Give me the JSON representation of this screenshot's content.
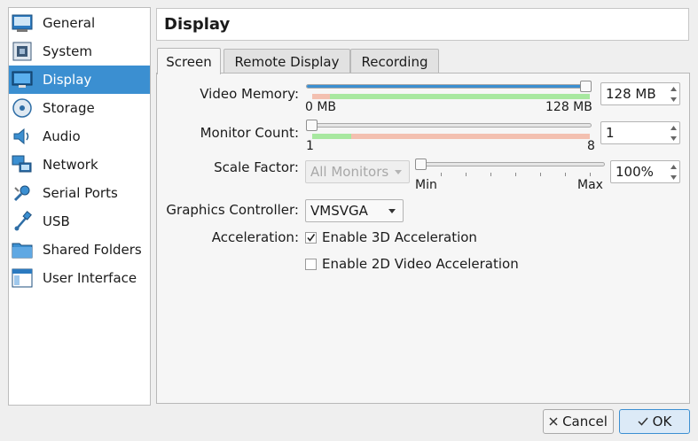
{
  "sidebar": {
    "items": [
      {
        "label": "General",
        "icon": "general-icon"
      },
      {
        "label": "System",
        "icon": "system-icon"
      },
      {
        "label": "Display",
        "icon": "display-icon",
        "selected": true
      },
      {
        "label": "Storage",
        "icon": "storage-icon"
      },
      {
        "label": "Audio",
        "icon": "audio-icon"
      },
      {
        "label": "Network",
        "icon": "network-icon"
      },
      {
        "label": "Serial Ports",
        "icon": "serial-ports-icon"
      },
      {
        "label": "USB",
        "icon": "usb-icon"
      },
      {
        "label": "Shared Folders",
        "icon": "shared-folders-icon"
      },
      {
        "label": "User Interface",
        "icon": "user-interface-icon"
      }
    ]
  },
  "header": {
    "title": "Display"
  },
  "tabs": [
    {
      "label": "Screen",
      "active": true
    },
    {
      "label": "Remote Display"
    },
    {
      "label": "Recording"
    }
  ],
  "screen": {
    "video_memory": {
      "label": "Video Memory:",
      "min_label": "0 MB",
      "max_label": "128 MB",
      "value": "128 MB",
      "fraction": 1.0
    },
    "monitor_count": {
      "label": "Monitor Count:",
      "min_label": "1",
      "max_label": "8",
      "value": "1",
      "fraction": 0.0
    },
    "scale_factor": {
      "label": "Scale Factor:",
      "combo_value": "All Monitors",
      "min_label": "Min",
      "max_label": "Max",
      "value": "100%",
      "fraction": 0.0
    },
    "graphics_controller": {
      "label": "Graphics Controller:",
      "value": "VMSVGA"
    },
    "acceleration": {
      "label": "Acceleration:",
      "enable_3d": {
        "label": "Enable 3D Acceleration",
        "checked": true
      },
      "enable_2d": {
        "label": "Enable 2D Video Acceleration",
        "checked": false
      }
    }
  },
  "buttons": {
    "cancel": "Cancel",
    "ok": "OK"
  },
  "colors": {
    "accent": "#3b8fd1",
    "band_good": "#a8e8a0",
    "band_bad": "#f3c0b0"
  }
}
